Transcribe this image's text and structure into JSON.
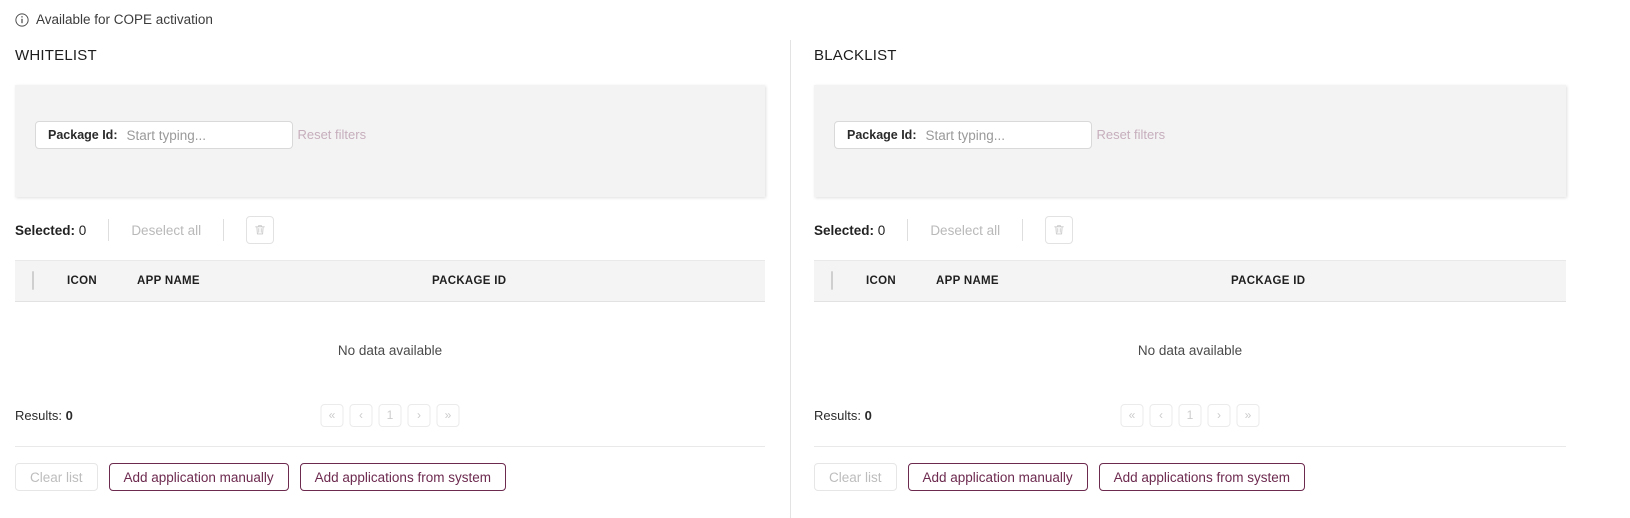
{
  "note": {
    "icon": "info-circle-icon",
    "text": "Available for COPE activation"
  },
  "colors": {
    "accent": "#6d2a4f",
    "link_disabled": "#c6aebc",
    "panel_bg": "#f3f3f3",
    "table_head_bg": "#f4f4f4",
    "text": "#232323"
  },
  "common": {
    "filter_label": "Package Id:",
    "filter_value": "",
    "filter_placeholder": "Start typing...",
    "reset_filters": "Reset filters",
    "selected_label": "Selected:",
    "selected_count": "0",
    "deselect_all": "Deselect all",
    "delete_icon": "trash-icon",
    "columns": [
      "ICON",
      "APP NAME",
      "PACKAGE ID"
    ],
    "empty_text": "No data available",
    "results_label": "Results:",
    "results_count": "0",
    "pagination": [
      {
        "name": "first",
        "glyph": "«"
      },
      {
        "name": "prev",
        "glyph": "‹"
      },
      {
        "name": "page-1",
        "glyph": "1"
      },
      {
        "name": "next",
        "glyph": "›"
      },
      {
        "name": "last",
        "glyph": "»"
      }
    ],
    "buttons": {
      "clear_list": "Clear list",
      "add_manually": "Add application manually",
      "add_from_system": "Add applications from system"
    }
  },
  "panels": [
    {
      "id": "whitelist",
      "title": "WHITELIST"
    },
    {
      "id": "blacklist",
      "title": "BLACKLIST"
    }
  ]
}
